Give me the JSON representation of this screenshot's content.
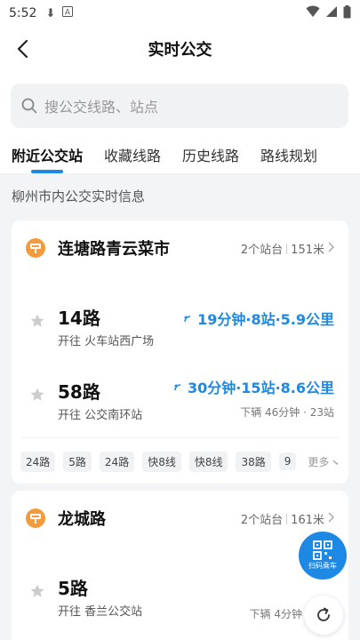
{
  "status_bar": {
    "time": "5:52"
  },
  "header": {
    "title": "实时公交"
  },
  "search": {
    "placeholder": "搜公交线路、站点"
  },
  "tabs": [
    {
      "label": "附近公交站",
      "active": true
    },
    {
      "label": "收藏线路",
      "active": false
    },
    {
      "label": "历史线路",
      "active": false
    },
    {
      "label": "路线规划",
      "active": false
    }
  ],
  "section_label": "柳州市内公交实时信息",
  "stops": [
    {
      "name": "连塘路青云菜市",
      "platforms": "2个站台",
      "distance": "151米",
      "routes": [
        {
          "number": "14路",
          "destination": "开往 火车站西广场",
          "eta": "19分钟·8站·5.9公里",
          "next": ""
        },
        {
          "number": "58路",
          "destination": "开往 公交南环站",
          "eta": "30分钟·15站·8.6公里",
          "next": "下辆 46分钟 · 23站"
        }
      ],
      "chips": [
        "24路",
        "5路",
        "24路",
        "快8线",
        "快8线",
        "38路",
        "9"
      ],
      "more_label": "更多"
    },
    {
      "name": "龙城路",
      "platforms": "2个站台",
      "distance": "161米",
      "routes": [
        {
          "number": "5路",
          "destination": "开往 香兰公交站",
          "eta": "",
          "next": "下辆 4分钟"
        }
      ]
    }
  ],
  "fab": {
    "ride_label": "扫码乘车"
  },
  "colors": {
    "accent": "#1e88e5",
    "stop_icon": "#f39a3d",
    "background": "#f3f4f6"
  }
}
